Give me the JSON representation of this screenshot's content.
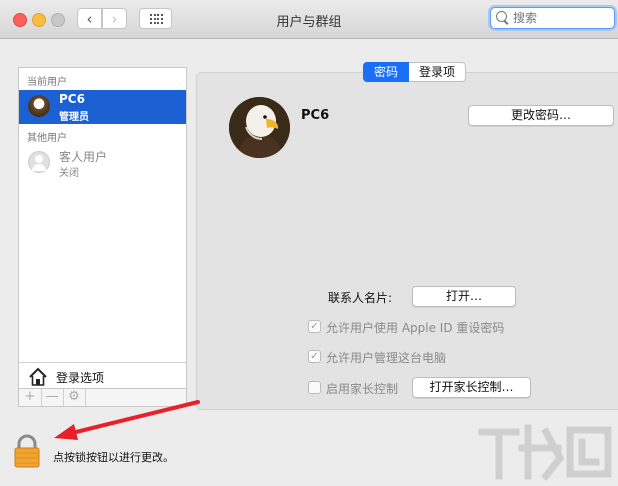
{
  "window": {
    "title": "用户与群组"
  },
  "toolbar": {
    "back_icon": "chevron-left-icon",
    "forward_icon": "chevron-right-icon",
    "grid_icon": "show-all-grid-icon"
  },
  "search": {
    "placeholder": "搜索",
    "value": ""
  },
  "sidebar": {
    "current_users_header": "当前用户",
    "current_user": {
      "name": "PC6",
      "role": "管理员"
    },
    "other_users_header": "其他用户",
    "guest_user": {
      "name": "客人用户",
      "status": "关闭"
    },
    "login_options_label": "登录选项",
    "tools": {
      "add": "+",
      "remove": "—"
    }
  },
  "tabs": [
    {
      "label": "密码",
      "active": true
    },
    {
      "label": "登录项",
      "active": false
    }
  ],
  "profile": {
    "name": "PC6",
    "change_password_button": "更改密码…"
  },
  "contact_card": {
    "label": "联系人名片:",
    "open_button": "打开…"
  },
  "options": [
    {
      "label": "允许用户使用 Apple ID 重设密码",
      "checked": true,
      "enabled": false
    },
    {
      "label": "允许用户管理这台电脑",
      "checked": true,
      "enabled": false
    },
    {
      "label": "启用家长控制",
      "checked": false,
      "enabled": false
    }
  ],
  "parental_button": "打开家长控制…",
  "lock": {
    "text": "点按锁按钮以进行更改。"
  },
  "colors": {
    "selection": "#1b61d3",
    "tab_active": "#1b6ff6",
    "arrow": "#e8202a",
    "lock_body": "#f2a431"
  }
}
